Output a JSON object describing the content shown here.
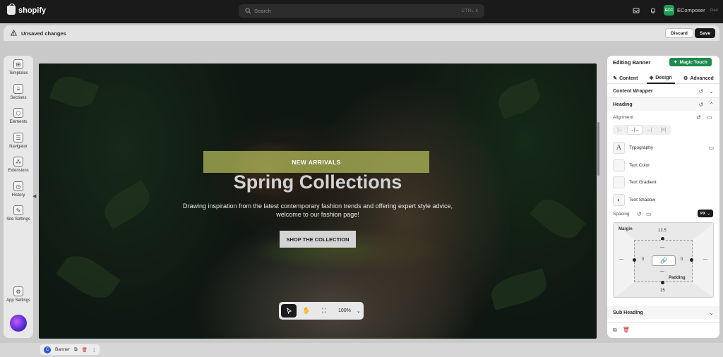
{
  "topbar": {
    "brand": "shopify",
    "search_placeholder": "Search",
    "search_shortcut": "CTRL K",
    "store_initials": "ECC",
    "store_name": "EComposer",
    "store_sub": "Gao"
  },
  "savebar": {
    "message": "Unsaved changes",
    "discard_label": "Discard",
    "save_label": "Save"
  },
  "sidebar": {
    "items": [
      {
        "label": "Templates",
        "icon": "templates-icon"
      },
      {
        "label": "Sections",
        "icon": "sections-icon"
      },
      {
        "label": "Elements",
        "icon": "elements-icon"
      },
      {
        "label": "Navigator",
        "icon": "navigator-icon"
      },
      {
        "label": "Extensions",
        "icon": "extensions-icon"
      },
      {
        "label": "History",
        "icon": "history-icon"
      },
      {
        "label": "Site Settings",
        "icon": "site-settings-icon"
      }
    ],
    "app_settings_label": "App Settings"
  },
  "banner": {
    "tag": "NEW ARRIVALS",
    "title": "Spring Collections",
    "description": "Drawing inspiration from the latest contemporary fashion trends and offering expert style advice, welcome to our fashion page!",
    "button_label": "SHOP THE COLLECTION"
  },
  "canvas_toolbar": {
    "zoom": "100%"
  },
  "panel": {
    "title": "Editing Banner",
    "magic_label": "Magic Touch",
    "tabs": [
      {
        "label": "Content",
        "selected": false
      },
      {
        "label": "Design",
        "selected": true
      },
      {
        "label": "Advanced",
        "selected": false
      }
    ],
    "content_wrapper_label": "Content Wrapper",
    "heading_label": "Heading",
    "alignment_label": "Alignment",
    "typography_label": "Typography",
    "typography_glyph": "A",
    "text_color_label": "Text Color",
    "text_gradient_label": "Text Gradient",
    "text_shadow_label": "Text Shadow",
    "spacing_label": "Spacing",
    "unit": "PX",
    "margin_label": "Margin",
    "padding_label": "Padding",
    "margin_top": "12.5",
    "margin_bottom": "15",
    "margin_left": "0",
    "margin_right": "0",
    "sub_heading_label": "Sub Heading"
  },
  "crumb": {
    "icon_letter": "C",
    "label": "Banner"
  },
  "colors": {
    "accent": "#1f8a4c",
    "dark": "#1a1a1a",
    "banner_tag_bg": "#b4be5a"
  }
}
